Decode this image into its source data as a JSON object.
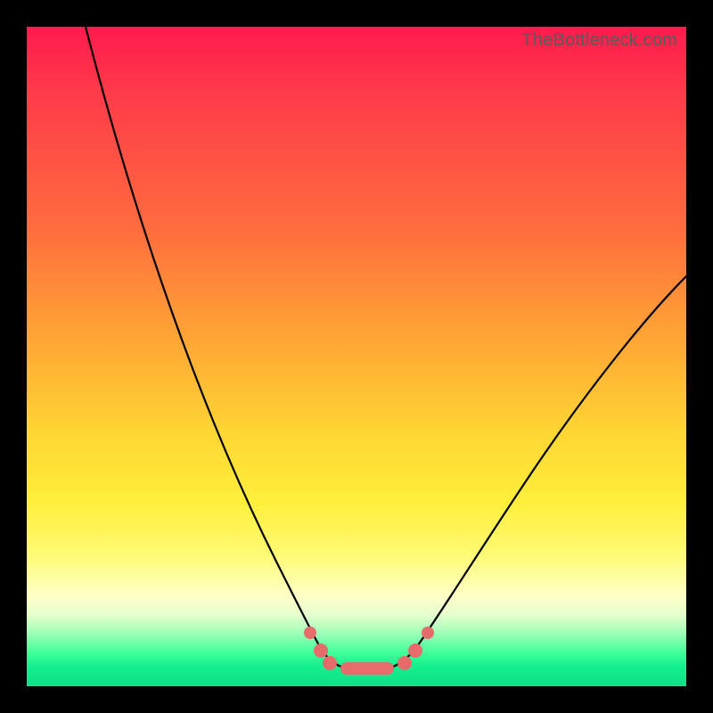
{
  "watermark": "TheBottleneck.com",
  "colors": {
    "frame": "#000000",
    "marker": "#e86b6b",
    "curve": "#000000",
    "gradient_top": "#ff1a4d",
    "gradient_bottom": "#0ee087"
  },
  "chart_data": {
    "type": "line",
    "title": "",
    "xlabel": "",
    "ylabel": "",
    "xlim": [
      0,
      100
    ],
    "ylim": [
      0,
      100
    ],
    "note": "Axes unlabeled in source image; x and y expressed as 0–100 percent of plot area. Curve is a V-shaped bottleneck profile with minimum near x≈50.",
    "series": [
      {
        "name": "bottleneck-curve",
        "x": [
          10,
          15,
          20,
          25,
          30,
          35,
          38,
          41,
          43,
          46,
          48,
          50,
          52,
          54,
          56,
          59,
          62,
          66,
          72,
          80,
          90,
          100
        ],
        "y": [
          100,
          86,
          72,
          59,
          46,
          34,
          26,
          19,
          13,
          7,
          4,
          3,
          3,
          4,
          6,
          10,
          15,
          22,
          32,
          44,
          56,
          66
        ]
      }
    ],
    "markers": {
      "description": "Salmon dots highlighting the flat trough of the curve",
      "x": [
        43,
        45,
        47,
        49,
        51,
        53,
        55,
        57,
        59
      ],
      "y": [
        11,
        6,
        4,
        3,
        3,
        3,
        4,
        7,
        11
      ]
    }
  }
}
